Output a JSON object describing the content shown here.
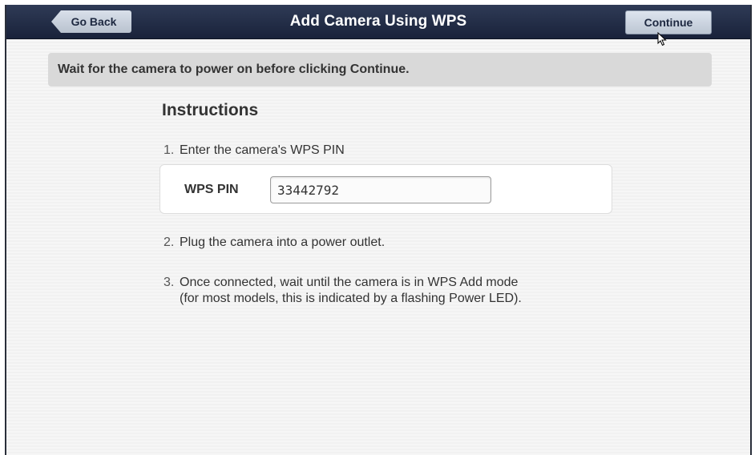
{
  "header": {
    "title": "Add Camera Using WPS",
    "back_label": "Go Back",
    "continue_label": "Continue"
  },
  "banner": {
    "text": "Wait for the camera to power on before clicking Continue."
  },
  "instructions": {
    "heading": "Instructions",
    "steps": [
      {
        "number": "1.",
        "text": "Enter the camera's WPS PIN"
      },
      {
        "number": "2.",
        "text": "Plug the camera into a power outlet."
      },
      {
        "number": "3.",
        "text": "Once connected, wait until the camera is in WPS Add mode",
        "text2": "(for most models, this is indicated by a flashing Power LED)."
      }
    ]
  },
  "pin": {
    "label": "WPS PIN",
    "value": "33442792"
  },
  "colors": {
    "titlebar": "#1f2a44",
    "banner": "#d9d9d9",
    "text": "#333333"
  }
}
